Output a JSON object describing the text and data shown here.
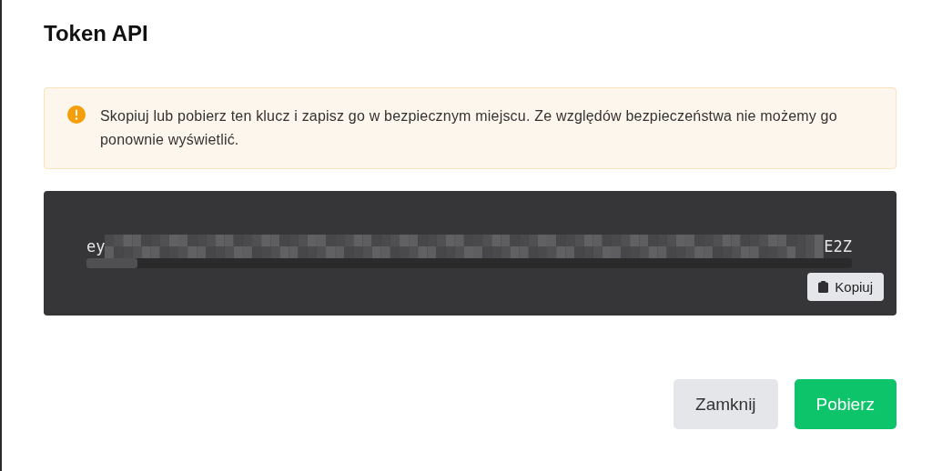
{
  "dialog": {
    "title": "Token API"
  },
  "alert": {
    "text": "Skopiuj lub pobierz ten klucz i zapisz go w bezpiecznym miejscu. Ze względów bezpieczeństwa nie możemy go ponownie wyświetlić."
  },
  "token": {
    "start": "ey",
    "end": "E2Z",
    "copy_label": "Kopiuj"
  },
  "buttons": [
    {
      "label": "Zamknij",
      "kind": "secondary"
    },
    {
      "label": "Pobierz",
      "kind": "primary"
    }
  ]
}
